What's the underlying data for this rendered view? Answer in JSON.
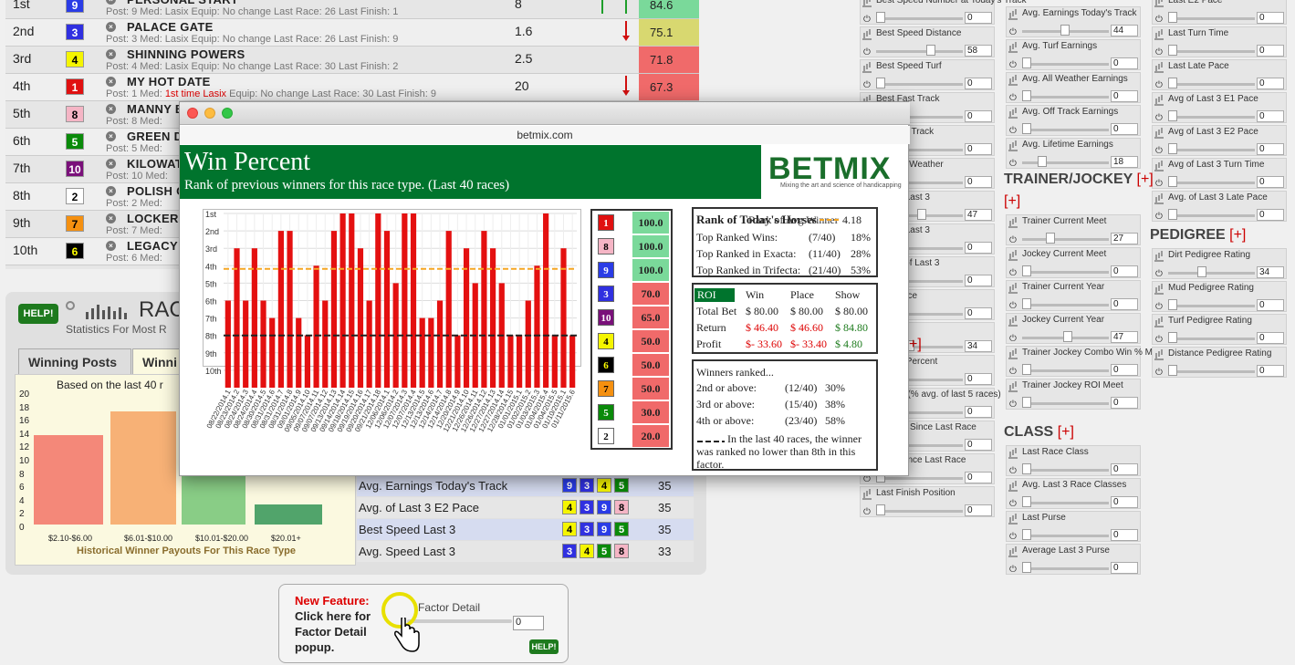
{
  "entries": [
    {
      "place": "1st",
      "pp": "9",
      "pp_bg": "#2a3ce6",
      "pp_fg": "#fff",
      "name": "PERSONAL START",
      "meta": "Post: 9   Med: Lasix   Equip: No change   Last Race: 26   Last Finish: 1",
      "odds": "8",
      "score": "84.6",
      "score_bg": "#7ad99a",
      "arrows": "up2"
    },
    {
      "place": "2nd",
      "pp": "3",
      "pp_bg": "#3030e0",
      "pp_fg": "#fff",
      "name": "PALACE GATE",
      "meta": "Post: 3   Med: Lasix   Equip: No change   Last Race: 26   Last Finish: 9",
      "odds": "1.6",
      "score": "75.1",
      "score_bg": "#d8d870",
      "arrows": "down"
    },
    {
      "place": "3rd",
      "pp": "4",
      "pp_bg": "#f5f500",
      "pp_fg": "#000",
      "name": "SHINNING POWERS",
      "meta": "Post: 4   Med: Lasix   Equip: No change   Last Race: 30   Last Finish: 2",
      "odds": "2.5",
      "score": "71.8",
      "score_bg": "#f06a6a",
      "arrows": ""
    },
    {
      "place": "4th",
      "pp": "1",
      "pp_bg": "#e01010",
      "pp_fg": "#fff",
      "name": "MY HOT DATE",
      "meta_pre": "Post: 1   Med: ",
      "meta_red": "1st time Lasix",
      "meta_post": "   Equip: No change   Last Race: 30   Last Finish: 9",
      "odds": "20",
      "score": "67.3",
      "score_bg": "#f06a6a",
      "arrows": "down"
    },
    {
      "place": "5th",
      "pp": "8",
      "pp_bg": "#f5b5c5",
      "pp_fg": "#000",
      "name": "MANNY B",
      "meta": "Post: 8   Med:",
      "odds": "",
      "score": "",
      "score_bg": "#f06a6a",
      "arrows": ""
    },
    {
      "place": "6th",
      "pp": "5",
      "pp_bg": "#0a8a0a",
      "pp_fg": "#fff",
      "name": "GREEN D",
      "meta": "Post: 5   Med:",
      "odds": "",
      "score": "",
      "score_bg": "#f06a6a",
      "arrows": ""
    },
    {
      "place": "7th",
      "pp": "10",
      "pp_bg": "#7a107a",
      "pp_fg": "#fff",
      "name": "KILOWAT",
      "meta": "Post: 10   Med:",
      "odds": "",
      "score": "",
      "score_bg": "#f06a6a",
      "arrows": ""
    },
    {
      "place": "8th",
      "pp": "2",
      "pp_bg": "#ffffff",
      "pp_fg": "#000",
      "name": "POLISH C",
      "meta": "Post: 2   Med:",
      "odds": "",
      "score": "",
      "score_bg": "#f06a6a",
      "arrows": ""
    },
    {
      "place": "9th",
      "pp": "7",
      "pp_bg": "#f59010",
      "pp_fg": "#000",
      "name": "LOCKER I",
      "meta": "Post: 7   Med:",
      "odds": "",
      "score": "",
      "score_bg": "#f06a6a",
      "arrows": ""
    },
    {
      "place": "10th",
      "pp": "6",
      "pp_bg": "#000000",
      "pp_fg": "#ff0",
      "name": "LEGACY C",
      "meta": "Post: 6   Med:",
      "odds": "",
      "score": "",
      "score_bg": "#f06a6a",
      "arrows": ""
    }
  ],
  "lower": {
    "help": "HELP!",
    "title": "RAC",
    "subtitle": "Statistics For Most R",
    "tabs": [
      "Winning Posts",
      "Winni"
    ],
    "payout_caption": "Based on the last 40 r",
    "payout_footer": "Historical Winner Payouts For This Race Type",
    "payout_yticks": [
      "20",
      "18",
      "16",
      "14",
      "12",
      "10",
      "8",
      "6",
      "4",
      "2",
      "0"
    ],
    "payout_x": [
      "$2.10-$6.00",
      "$6.01-$10.00",
      "$10.01-$20.00",
      "$20.01+"
    ],
    "factors": [
      {
        "label": "Avg. Earnings Today's Track",
        "chips": [
          "9",
          "3",
          "4",
          "5"
        ],
        "value": "35"
      },
      {
        "label": "Avg. of Last 3 E2 Pace",
        "chips": [
          "4",
          "3",
          "9",
          "8"
        ],
        "value": "35"
      },
      {
        "label": "Best Speed Last 3",
        "chips": [
          "4",
          "3",
          "9",
          "5"
        ],
        "value": "35"
      },
      {
        "label": "Avg. Speed Last 3",
        "chips": [
          "3",
          "4",
          "5",
          "8"
        ],
        "value": "33"
      }
    ]
  },
  "newfeature": {
    "title": "New Feature:",
    "body": "Click here for Factor Detail popup.",
    "factor": "Factor Detail",
    "value": "0",
    "help": "HELP!"
  },
  "chip_colors": {
    "1": [
      "#e01010",
      "#fff"
    ],
    "2": [
      "#fff",
      "#000"
    ],
    "3": [
      "#3030e0",
      "#fff"
    ],
    "4": [
      "#f5f500",
      "#000"
    ],
    "5": [
      "#0a8a0a",
      "#fff"
    ],
    "6": [
      "#000",
      "#ff0"
    ],
    "7": [
      "#f59010",
      "#000"
    ],
    "8": [
      "#f5b5c5",
      "#000"
    ],
    "9": [
      "#2a3ce6",
      "#fff"
    ],
    "10": [
      "#7a107a",
      "#fff"
    ]
  },
  "sidebar": {
    "col1": [
      {
        "label": "Best Speed Number at Today's Track",
        "value": "0"
      },
      {
        "label": "Best Speed Distance",
        "value": "58"
      },
      {
        "label": "Best Speed Turf",
        "value": "0"
      },
      {
        "label": "Best Fast Track",
        "value": "0"
      },
      {
        "label": "Best Off Track",
        "value": "0"
      },
      {
        "label": "Best All Weather",
        "value": "0"
      },
      {
        "label": "Speed Last 3",
        "value": "47"
      },
      {
        "label": "Speed Last 3",
        "value": "0"
      },
      {
        "label": "Best 2 of Last 3",
        "value": "0"
      },
      {
        "label": "Last Race",
        "value": "0"
      },
      {
        "label": "cent",
        "value": "34"
      },
      {
        "label": "Money Percent",
        "value": "0"
      },
      {
        "label": "Beaten (% avg. of last 5 races)",
        "value": "0"
      },
      {
        "label": "Worked Since Last Race",
        "value": "0"
      },
      {
        "label": "Days Since Last Race",
        "value": "0"
      },
      {
        "label": "Last Finish Position",
        "value": "0"
      }
    ],
    "col2a": [
      {
        "label": "Avg. Earnings Today's Track",
        "value": "44"
      },
      {
        "label": "Avg. Turf Earnings",
        "value": "0"
      },
      {
        "label": "Avg. All Weather Earnings",
        "value": "0"
      },
      {
        "label": "Avg. Off Track Earnings",
        "value": "0"
      },
      {
        "label": "Avg. Lifetime Earnings",
        "value": "18"
      }
    ],
    "tj_head": "TRAINER/JOCKEY",
    "col2b": [
      {
        "label": "Trainer Current Meet",
        "value": "27"
      },
      {
        "label": "Jockey Current Meet",
        "value": "0"
      },
      {
        "label": "Trainer Current Year",
        "value": "0"
      },
      {
        "label": "Jockey Current Year",
        "value": "47"
      },
      {
        "label": "Trainer Jockey Combo Win % Meet",
        "value": "0"
      },
      {
        "label": "Trainer Jockey ROI Meet",
        "value": "0"
      }
    ],
    "class_head": "CLASS",
    "col2c": [
      {
        "label": "Last Race Class",
        "value": "0"
      },
      {
        "label": "Avg. Last 3 Race Classes",
        "value": "0"
      },
      {
        "label": "Last Purse",
        "value": "0"
      },
      {
        "label": "Average Last 3 Purse",
        "value": "0"
      }
    ],
    "col3a": [
      {
        "label": "Last E2 Pace",
        "value": "0"
      },
      {
        "label": "Last Turn Time",
        "value": "0"
      },
      {
        "label": "Last Late Pace",
        "value": "0"
      },
      {
        "label": "Avg of Last 3 E1 Pace",
        "value": "0"
      },
      {
        "label": "Avg of Last 3 E2 Pace",
        "value": "0"
      },
      {
        "label": "Avg of Last 3 Turn Time",
        "value": "0"
      },
      {
        "label": "Avg. of Last 3 Late Pace",
        "value": "0"
      }
    ],
    "ped_head": "PEDIGREE",
    "col3b": [
      {
        "label": "Dirt Pedigree Rating",
        "value": "34"
      },
      {
        "label": "Mud Pedigree Rating",
        "value": "0"
      },
      {
        "label": "Turf Pedigree Rating",
        "value": "0"
      },
      {
        "label": "Distance Pedigree Rating",
        "value": "0"
      }
    ],
    "plus": "[+]",
    "col1_plus": "+]"
  },
  "popup": {
    "url": "betmix.com",
    "title": "Win Percent",
    "subtitle": "Rank of previous winners for this race type. (Last 40 races)",
    "logo": "BETMIX",
    "tagline": "Mixing the art and science of handicapping",
    "ranks": [
      {
        "pp": "1",
        "score": "100.0",
        "bg": "#7ad99a"
      },
      {
        "pp": "8",
        "score": "100.0",
        "bg": "#7ad99a"
      },
      {
        "pp": "9",
        "score": "100.0",
        "bg": "#7ad99a"
      },
      {
        "pp": "3",
        "score": "70.0",
        "bg": "#f06a6a"
      },
      {
        "pp": "10",
        "score": "65.0",
        "bg": "#f06a6a"
      },
      {
        "pp": "4",
        "score": "50.0",
        "bg": "#f06a6a"
      },
      {
        "pp": "6",
        "score": "50.0",
        "bg": "#f06a6a"
      },
      {
        "pp": "7",
        "score": "50.0",
        "bg": "#f06a6a"
      },
      {
        "pp": "5",
        "score": "30.0",
        "bg": "#f06a6a"
      },
      {
        "pp": "2",
        "score": "20.0",
        "bg": "#f06a6a"
      }
    ],
    "stats": {
      "heading": "Rank of Today's Horses",
      "avg_label": "Rank of Avg Winner",
      "avg_value": "4.18",
      "rows": [
        {
          "label": "Top Ranked Wins:",
          "frac": "(7/40)",
          "pct": "18%"
        },
        {
          "label": "Top Ranked in Exacta:",
          "frac": "(11/40)",
          "pct": "28%"
        },
        {
          "label": "Top Ranked in Trifecta:",
          "frac": "(21/40)",
          "pct": "53%"
        }
      ]
    },
    "roi": {
      "head": [
        "ROI",
        "Win",
        "Place",
        "Show"
      ],
      "rows": [
        {
          "label": "Total Bet",
          "win": "$ 80.00",
          "place": "$ 80.00",
          "show": "$ 80.00"
        },
        {
          "label": "Return",
          "win": "$ 46.40",
          "place": "$ 46.60",
          "show": "$ 84.80"
        },
        {
          "label": "Profit",
          "win": "$- 33.60",
          "place": "$- 33.40",
          "show": "$ 4.80"
        }
      ]
    },
    "winners": {
      "title": "Winners ranked...",
      "rows": [
        {
          "label": "2nd or above:",
          "frac": "(12/40)",
          "pct": "30%"
        },
        {
          "label": "3rd or above:",
          "frac": "(15/40)",
          "pct": "38%"
        },
        {
          "label": "4th or above:",
          "frac": "(23/40)",
          "pct": "58%"
        }
      ],
      "note": "In the last 40 races, the winner was ranked no lower than 8th in this factor."
    }
  },
  "chart_data": {
    "type": "bar",
    "title": "",
    "ylabel": "",
    "y_ticks": [
      "1st",
      "2nd",
      "3rd",
      "4th",
      "5th",
      "6th",
      "7th",
      "8th",
      "9th",
      "10th"
    ],
    "avg_line": 4.18,
    "cutoff_line": 8,
    "bar_color": "#e41010",
    "categories": [
      "08/22/2014.1",
      "08/23/2014.2",
      "08/24/2014.3",
      "08/24/2014.4",
      "08/30/2014.5",
      "08/31/2014.6",
      "08/31/2014.7",
      "08/31/2014.8",
      "09/01/2014.9",
      "09/05/2014.10",
      "09/07/2014.11",
      "09/07/2014.12",
      "09/13/2014.13",
      "09/14/2014.14",
      "09/18/2014.15",
      "09/19/2014.16",
      "09/20/2014.17",
      "09/21/2014.18",
      "12/06/2014.1",
      "12/06/2014.2",
      "12/07/2014.3",
      "12/07/2014.4",
      "12/13/2014.5",
      "12/13/2014.6",
      "12/14/2014.7",
      "12/14/2014.8",
      "12/20/2014.9",
      "12/21/2014.10",
      "12/26/2014.11",
      "12/26/2014.12",
      "12/27/2014.13",
      "12/27/2014.14",
      "12/28/2014.15",
      "01/01/2015.1",
      "01/02/2015.2",
      "01/03/2015.3",
      "01/04/2015.4",
      "01/04/2015.5",
      "01/10/2015.1",
      "01/11/2015.6"
    ],
    "values": [
      6,
      3,
      6,
      3,
      6,
      7,
      2,
      2,
      7,
      8,
      4,
      6,
      2,
      1,
      1,
      3,
      6,
      1,
      2,
      5,
      1,
      1,
      7,
      7,
      6,
      2,
      8,
      3,
      5,
      2,
      3,
      5,
      8,
      8,
      6,
      4,
      1,
      8,
      3,
      8
    ]
  }
}
